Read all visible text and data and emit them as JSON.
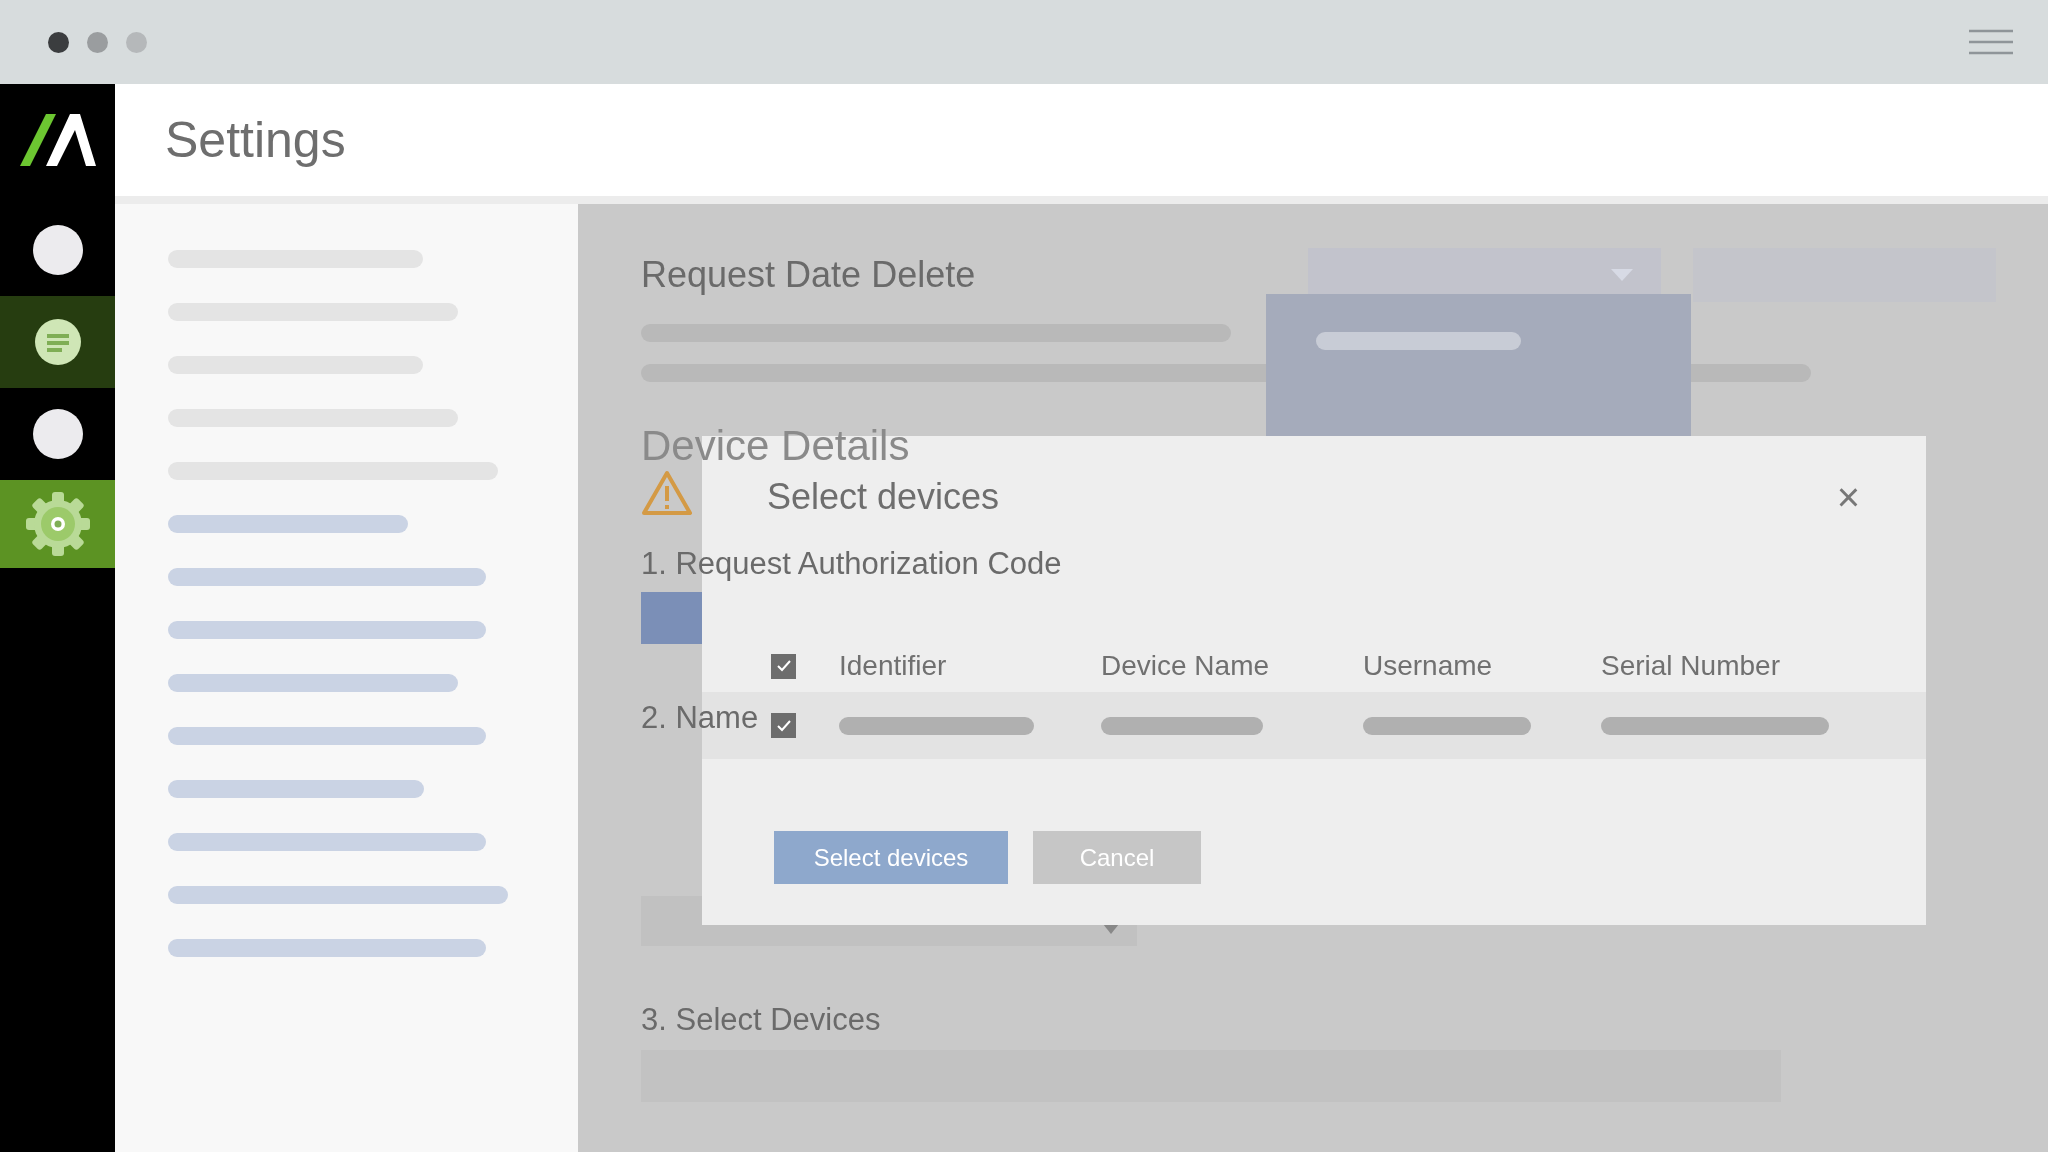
{
  "header": {
    "title": "Settings"
  },
  "nav": [
    {
      "kind": "circle",
      "selected": false,
      "highlighted": false
    },
    {
      "kind": "document",
      "selected": false,
      "highlighted": true
    },
    {
      "kind": "circle",
      "selected": false,
      "highlighted": false
    },
    {
      "kind": "gear",
      "selected": true,
      "highlighted": false
    }
  ],
  "page": {
    "title": "Request Date Delete",
    "section": "Device Details",
    "steps": [
      "1. Request Authorization Code",
      "2. Name",
      "3. Select Devices"
    ]
  },
  "dialog": {
    "title": "Select devices",
    "close": "×",
    "all_checked": true,
    "columns": [
      "Identifier",
      "Device Name",
      "Username",
      "Serial Number"
    ],
    "rows": [
      {
        "checked": true
      }
    ],
    "buttons": [
      {
        "label": "Select devices",
        "kind": "primary"
      },
      {
        "label": "Cancel",
        "kind": "secondary"
      }
    ]
  }
}
